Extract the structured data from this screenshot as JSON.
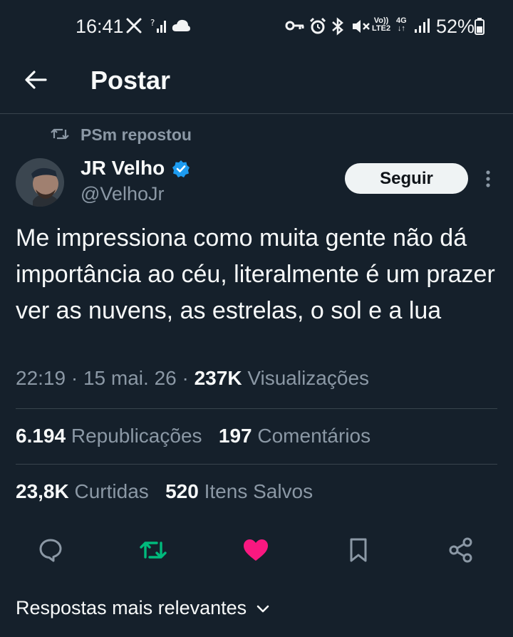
{
  "status_bar": {
    "time": "16:41",
    "battery": "52%",
    "icons": [
      "x-logo-icon",
      "no-signal-icon",
      "cloud-icon",
      "key-icon",
      "alarm-icon",
      "bluetooth-icon",
      "mute-icon",
      "volte-icon",
      "4g-icon",
      "signal-icon",
      "battery-icon"
    ],
    "volte_top": "Vo))",
    "volte_bottom": "LTE2",
    "network": "4G"
  },
  "header": {
    "title": "Postar"
  },
  "repost": {
    "label": "PSm repostou"
  },
  "author": {
    "name": "JR Velho",
    "handle": "@VelhoJr",
    "verified_color": "#1d9bf0"
  },
  "follow_button": {
    "label": "Seguir"
  },
  "tweet": {
    "text": "Me impressiona como muita gente não dá importância ao céu, literalmente é um prazer ver as nuvens, as estrelas, o sol e a lua",
    "time": "22:19",
    "date": "15 mai. 26",
    "views_count": "237K",
    "views_label": "Visualizações",
    "separator": " · "
  },
  "stats": {
    "reposts_count": "6.194",
    "reposts_label": "Republicações",
    "comments_count": "197",
    "comments_label": "Comentários",
    "likes_count": "23,8K",
    "likes_label": "Curtidas",
    "saves_count": "520",
    "saves_label": "Itens Salvos"
  },
  "actions": {
    "icons": [
      "reply-icon",
      "retweet-icon",
      "like-icon",
      "bookmark-icon",
      "share-icon"
    ],
    "retweet_color": "#00ba7c",
    "like_color": "#f91880"
  },
  "replies": {
    "sort_label": "Respostas mais relevantes"
  }
}
